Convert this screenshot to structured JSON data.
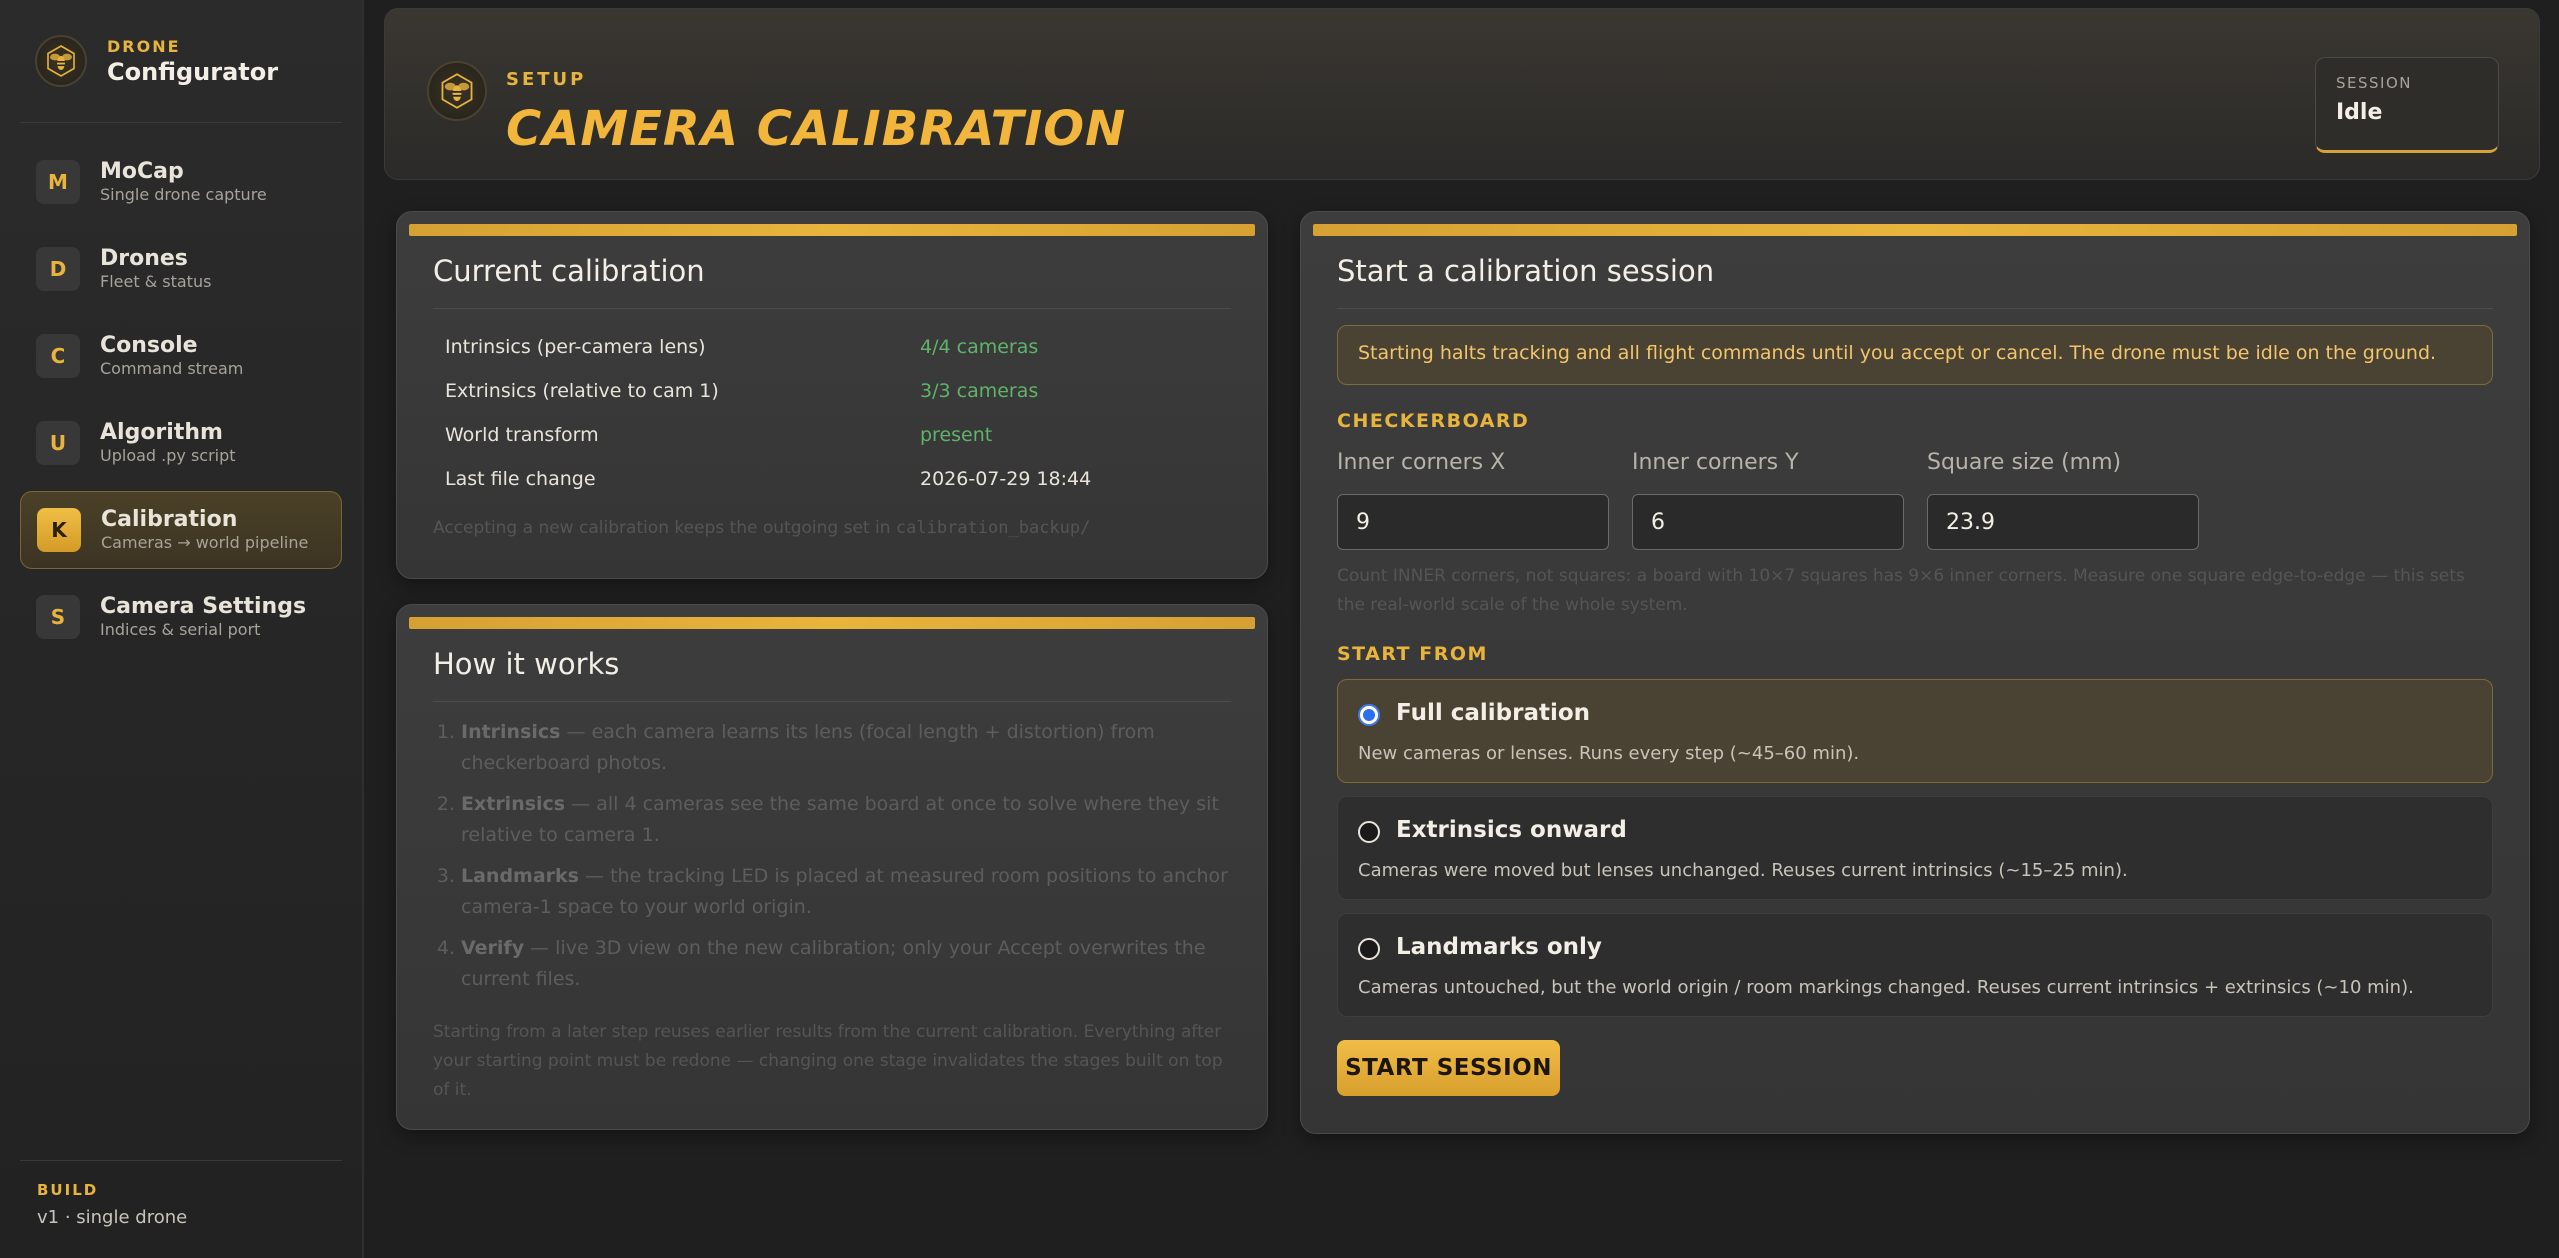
{
  "brand": {
    "small": "DRONE",
    "big": "Configurator"
  },
  "nav": [
    {
      "badge": "M",
      "title": "MoCap",
      "sub": "Single drone capture",
      "active": false
    },
    {
      "badge": "D",
      "title": "Drones",
      "sub": "Fleet & status",
      "active": false
    },
    {
      "badge": "C",
      "title": "Console",
      "sub": "Command stream",
      "active": false
    },
    {
      "badge": "U",
      "title": "Algorithm",
      "sub": "Upload .py script",
      "active": false
    },
    {
      "badge": "K",
      "title": "Calibration",
      "sub": "Cameras → world pipeline",
      "active": true
    },
    {
      "badge": "S",
      "title": "Camera Settings",
      "sub": "Indices & serial port",
      "active": false
    }
  ],
  "build": {
    "label": "BUILD",
    "value": "v1 · single drone"
  },
  "header": {
    "eyebrow": "SETUP",
    "title": "CAMERA CALIBRATION",
    "session_label": "SESSION",
    "session_value": "Idle"
  },
  "current": {
    "title": "Current calibration",
    "rows": [
      {
        "key": "Intrinsics (per-camera lens)",
        "value": "4/4 cameras"
      },
      {
        "key": "Extrinsics (relative to cam 1)",
        "value": "3/3 cameras"
      },
      {
        "key": "World transform",
        "value": "present"
      },
      {
        "key": "Last file change",
        "value": "2026-07-29 18:44"
      }
    ],
    "note_prefix": "Accepting a new calibration keeps the outgoing set in ",
    "note_code": "calibration_backup/"
  },
  "how": {
    "title": "How it works",
    "steps": [
      {
        "term": "Intrinsics",
        "text": " — each camera learns its lens (focal length + distortion) from checkerboard photos."
      },
      {
        "term": "Extrinsics",
        "text": " — all 4 cameras see the same board at once to solve where they sit relative to camera 1."
      },
      {
        "term": "Landmarks",
        "text": " — the tracking LED is placed at measured room positions to anchor camera-1 space to your world origin."
      },
      {
        "term": "Verify",
        "text": " — live 3D view on the new calibration; only your Accept overwrites the current files."
      }
    ],
    "footer": "Starting from a later step reuses earlier results from the current calibration. Everything after your starting point must be redone — changing one stage invalidates the stages built on top of it."
  },
  "start": {
    "title": "Start a calibration session",
    "warning": "Starting halts tracking and all flight commands until you accept or cancel. The drone must be idle on the ground.",
    "checkerboard_label": "CHECKERBOARD",
    "fields": [
      {
        "label": "Inner corners X",
        "value": "9"
      },
      {
        "label": "Inner corners Y",
        "value": "6"
      },
      {
        "label": "Square size (mm)",
        "value": "23.9"
      }
    ],
    "hint": "Count INNER corners, not squares: a board with 10×7 squares has 9×6 inner corners. Measure one square edge-to-edge — this sets the real-world scale of the whole system.",
    "start_from_label": "START FROM",
    "options": [
      {
        "title": "Full calibration",
        "desc": "New cameras or lenses. Runs every step (~45–60 min).",
        "selected": true
      },
      {
        "title": "Extrinsics onward",
        "desc": "Cameras were moved but lenses unchanged. Reuses current intrinsics (~15–25 min).",
        "selected": false
      },
      {
        "title": "Landmarks only",
        "desc": "Cameras untouched, but the world origin / room markings changed. Reuses current intrinsics + extrinsics (~10 min).",
        "selected": false
      }
    ],
    "button": "START SESSION"
  },
  "colors": {
    "accent": "#e9b43c",
    "ok": "#5fb36b",
    "radio": "#2c6ff0"
  },
  "icons": {
    "brand": "bee-icon"
  }
}
